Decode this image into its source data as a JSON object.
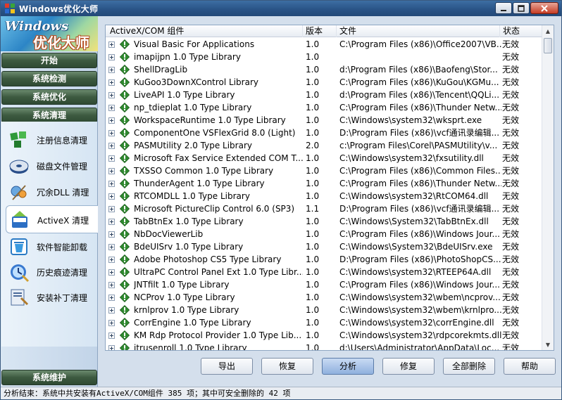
{
  "window": {
    "title": "Windows优化大师"
  },
  "logo": {
    "line1": "Windows",
    "line2": "优化大师"
  },
  "nav": [
    {
      "label": "开始"
    },
    {
      "label": "系统检测"
    },
    {
      "label": "系统优化"
    },
    {
      "label": "系统清理"
    },
    {
      "label": "系统维护"
    }
  ],
  "subnav": [
    {
      "label": "注册信息清理",
      "icon": "registry-cleaner-icon"
    },
    {
      "label": "磁盘文件管理",
      "icon": "disk-icon"
    },
    {
      "label": "冗余DLL 清理",
      "icon": "dll-icon"
    },
    {
      "label": "ActiveX 清理",
      "icon": "activex-icon",
      "active": true
    },
    {
      "label": "软件智能卸载",
      "icon": "uninstall-icon"
    },
    {
      "label": "历史痕迹清理",
      "icon": "history-icon"
    },
    {
      "label": "安装补丁清理",
      "icon": "patch-icon"
    }
  ],
  "list": {
    "columns": {
      "name": "ActiveX/COM 组件",
      "version": "版本",
      "file": "文件",
      "state": "状态"
    },
    "rows": [
      {
        "name": "Visual Basic For Applications",
        "version": "1.0",
        "file": "C:\\Program Files (x86)\\Office2007\\VB...",
        "state": "无效"
      },
      {
        "name": "imapijpn 1.0 Type Library",
        "version": "1.0",
        "file": "",
        "state": "无效"
      },
      {
        "name": "ShellDragLib",
        "version": "1.0",
        "file": "d:\\Program Files (x86)\\Baofeng\\Stor...",
        "state": "无效"
      },
      {
        "name": "KuGoo3DownXControl Library",
        "version": "1.0",
        "file": "C:\\Program Files (x86)\\KuGou\\KGMu...",
        "state": "无效"
      },
      {
        "name": "LiveAPI 1.0 Type Library",
        "version": "1.0",
        "file": "d:\\Program Files (x86)\\Tencent\\QQLi...",
        "state": "无效"
      },
      {
        "name": "np_tdieplat 1.0 Type Library",
        "version": "1.0",
        "file": "C:\\Program Files (x86)\\Thunder Netw...",
        "state": "无效"
      },
      {
        "name": "WorkspaceRuntime 1.0 Type Library",
        "version": "1.0",
        "file": "C:\\Windows\\system32\\wksprt.exe",
        "state": "无效"
      },
      {
        "name": "ComponentOne VSFlexGrid 8.0 (Light)",
        "version": "1.0",
        "file": "D:\\Program Files (x86)\\vcf通讯录编辑...",
        "state": "无效"
      },
      {
        "name": "PASMUtility 2.0 Type Library",
        "version": "2.0",
        "file": "c:\\Program Files\\Corel\\PASMUtility\\v...",
        "state": "无效"
      },
      {
        "name": "Microsoft Fax Service Extended COM T...",
        "version": "1.0",
        "file": "C:\\Windows\\system32\\fxsutility.dll",
        "state": "无效"
      },
      {
        "name": "TXSSO Common 1.0 Type Library",
        "version": "1.0",
        "file": "C:\\Program Files (x86)\\Common Files...",
        "state": "无效"
      },
      {
        "name": "ThunderAgent 1.0 Type Library",
        "version": "1.0",
        "file": "C:\\Program Files (x86)\\Thunder Netw...",
        "state": "无效"
      },
      {
        "name": "RTCOMDLL 1.0 Type Library",
        "version": "1.0",
        "file": "C:\\Windows\\system32\\RtCOM64.dll",
        "state": "无效"
      },
      {
        "name": "Microsoft PictureClip Control 6.0 (SP3)",
        "version": "1.1",
        "file": "D:\\Program Files (x86)\\vcf通讯录编辑...",
        "state": "无效"
      },
      {
        "name": "TabBtnEx 1.0 Type Library",
        "version": "1.0",
        "file": "C:\\Windows\\System32\\TabBtnEx.dll",
        "state": "无效"
      },
      {
        "name": "NbDocViewerLib",
        "version": "1.0",
        "file": "C:\\Program Files (x86)\\Windows Jour...",
        "state": "无效"
      },
      {
        "name": "BdeUISrv 1.0 Type Library",
        "version": "1.0",
        "file": "C:\\Windows\\System32\\BdeUISrv.exe",
        "state": "无效"
      },
      {
        "name": "Adobe Photoshop CS5 Type Library",
        "version": "1.0",
        "file": "D:\\Program Files (x86)\\PhotoShopCS...",
        "state": "无效"
      },
      {
        "name": "UltraPC Control Panel Ext 1.0 Type Libr...",
        "version": "1.0",
        "file": "C:\\Windows\\system32\\RTEEP64A.dll",
        "state": "无效"
      },
      {
        "name": "JNTfilt 1.0 Type Library",
        "version": "1.0",
        "file": "C:\\Program Files (x86)\\Windows Jour...",
        "state": "无效"
      },
      {
        "name": "NCProv 1.0 Type Library",
        "version": "1.0",
        "file": "C:\\Windows\\system32\\wbem\\ncprov...",
        "state": "无效"
      },
      {
        "name": "krnlprov 1.0 Type Library",
        "version": "1.0",
        "file": "C:\\Windows\\system32\\wbem\\krnlpro...",
        "state": "无效"
      },
      {
        "name": "CorrEngine 1.0 Type Library",
        "version": "1.0",
        "file": "C:\\Windows\\system32\\corrEngine.dll",
        "state": "无效"
      },
      {
        "name": "KM Rdp Protocol Provider 1.0 Type Lib...",
        "version": "1.0",
        "file": "C:\\Windows\\system32\\rdpcorekmts.dll",
        "state": "无效"
      },
      {
        "name": "itrusenroll 1.0 Type Library",
        "version": "1.0",
        "file": "d:\\Users\\Administrator\\AppData\\Loc...",
        "state": "无效"
      }
    ]
  },
  "buttons": {
    "export": "导出",
    "restore": "恢复",
    "analyze": "分析",
    "repair": "修复",
    "select_all": "全部删除",
    "help": "帮助"
  },
  "status": "分析结束：系统中共安装有ActiveX/COM组件 385 项；其中可安全删除的 42 项",
  "colors": {
    "nav_green": "#3d5a40",
    "ok_green": "#2f8a2f",
    "title_blue": "#2a5487"
  }
}
